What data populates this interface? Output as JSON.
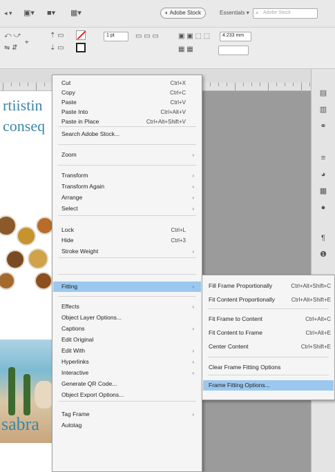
{
  "toolbar": {
    "adobe_stock_label": "Adobe Stock",
    "essentials_label": "Essentials",
    "search_placeholder": "Adobe Stock",
    "stroke_size": "1 pt",
    "width_value": "4.233 mm"
  },
  "page": {
    "heading_line1": "rtiistin",
    "heading_line2": "conseq",
    "footer_text": "sabra"
  },
  "context_menu": {
    "items": [
      {
        "label": "Cut",
        "shortcut": "Ctrl+X",
        "submenu": false
      },
      {
        "label": "Copy",
        "shortcut": "Ctrl+C",
        "submenu": false
      },
      {
        "label": "Paste",
        "shortcut": "Ctrl+V",
        "submenu": false
      },
      {
        "label": "Paste Into",
        "shortcut": "Ctrl+Alt+V",
        "submenu": false
      },
      {
        "label": "Paste in Place",
        "shortcut": "Ctrl+Alt+Shift+V",
        "submenu": false
      },
      {
        "label": "Search Adobe Stock...",
        "shortcut": "",
        "submenu": false
      },
      {
        "label": "Zoom",
        "shortcut": "",
        "submenu": true
      },
      {
        "label": "Transform",
        "shortcut": "",
        "submenu": true
      },
      {
        "label": "Transform Again",
        "shortcut": "",
        "submenu": true
      },
      {
        "label": "Arrange",
        "shortcut": "",
        "submenu": true
      },
      {
        "label": "Select",
        "shortcut": "",
        "submenu": true
      },
      {
        "label": "Lock",
        "shortcut": "Ctrl+L",
        "submenu": false
      },
      {
        "label": "Hide",
        "shortcut": "Ctrl+3",
        "submenu": false
      },
      {
        "label": "Stroke Weight",
        "shortcut": "",
        "submenu": true
      },
      {
        "label": "Fitting",
        "shortcut": "",
        "submenu": true,
        "highlighted": true
      },
      {
        "label": "Effects",
        "shortcut": "",
        "submenu": true
      },
      {
        "label": "Object Layer Options...",
        "shortcut": "",
        "submenu": false
      },
      {
        "label": "Captions",
        "shortcut": "",
        "submenu": true
      },
      {
        "label": "Edit Original",
        "shortcut": "",
        "submenu": false
      },
      {
        "label": "Edit With",
        "shortcut": "",
        "submenu": true
      },
      {
        "label": "Hyperlinks",
        "shortcut": "",
        "submenu": true
      },
      {
        "label": "Interactive",
        "shortcut": "",
        "submenu": true
      },
      {
        "label": "Generate QR Code...",
        "shortcut": "",
        "submenu": false
      },
      {
        "label": "Object Export Options...",
        "shortcut": "",
        "submenu": false
      },
      {
        "label": "Tag Frame",
        "shortcut": "",
        "submenu": true
      },
      {
        "label": "Autotag",
        "shortcut": "",
        "submenu": false
      }
    ]
  },
  "fitting_submenu": {
    "items": [
      {
        "label": "Fill Frame Proportionally",
        "shortcut": "Ctrl+Alt+Shift+C"
      },
      {
        "label": "Fit Content Proportionally",
        "shortcut": "Ctrl+Alt+Shift+E"
      },
      {
        "label": "Fit Frame to Content",
        "shortcut": "Ctrl+Alt+C"
      },
      {
        "label": "Fit Content to Frame",
        "shortcut": "Ctrl+Alt+E"
      },
      {
        "label": "Center Content",
        "shortcut": "Ctrl+Shift+E"
      },
      {
        "label": "Clear Frame Fitting Options",
        "shortcut": ""
      },
      {
        "label": "Frame Fitting Options...",
        "shortcut": "",
        "highlighted": true
      }
    ]
  },
  "colors": {
    "highlight": "#9bc8ee",
    "heading_text": "#3a86a8"
  }
}
